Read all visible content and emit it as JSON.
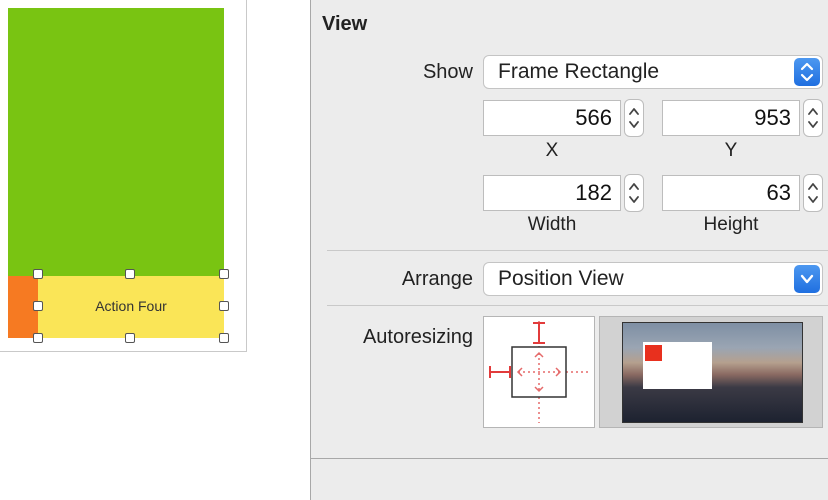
{
  "canvas": {
    "button_label": "Action Four",
    "colors": {
      "green": "#79c412",
      "yellow": "#fae557",
      "orange": "#f67a22"
    }
  },
  "inspector": {
    "section_title": "View",
    "show": {
      "label": "Show",
      "value": "Frame Rectangle"
    },
    "frame": {
      "x": {
        "value": "566",
        "label": "X"
      },
      "y": {
        "value": "953",
        "label": "Y"
      },
      "width": {
        "value": "182",
        "label": "Width"
      },
      "height": {
        "value": "63",
        "label": "Height"
      }
    },
    "arrange": {
      "label": "Arrange",
      "value": "Position View"
    },
    "autoresizing": {
      "label": "Autoresizing"
    },
    "accent_color": "#2b7de9"
  }
}
